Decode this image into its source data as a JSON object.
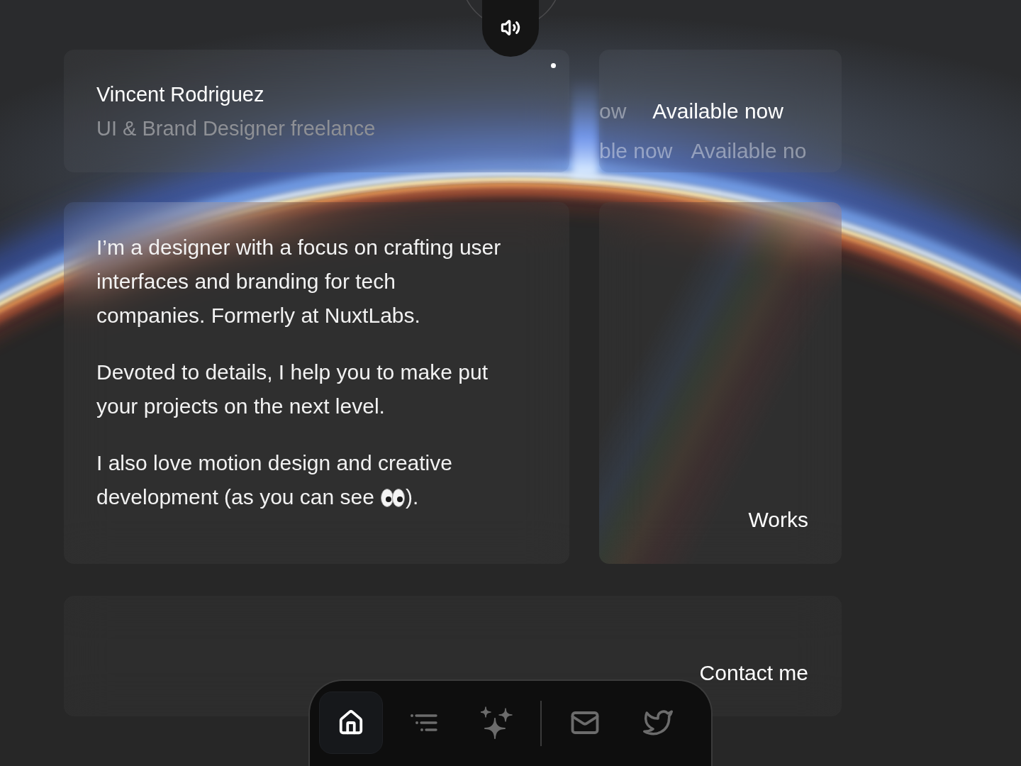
{
  "sound_button": {
    "on": true
  },
  "profile": {
    "name": "Vincent Rodriguez",
    "role": "UI & Brand Designer freelance"
  },
  "availability": {
    "rows": [
      {
        "items": [
          {
            "text": "ow",
            "faded": true
          },
          {
            "text": "Available now",
            "faded": false
          }
        ]
      },
      {
        "items": [
          {
            "text": "ble now",
            "faded": true
          },
          {
            "text": "Available no",
            "faded": true
          }
        ]
      }
    ]
  },
  "about": {
    "paragraphs": [
      {
        "parts": [
          "I’m a designer with a focus on crafting user interfaces and branding for tech companies. Formerly at NuxtLabs."
        ]
      },
      {
        "parts": [
          "Devoted to details, I help you to make put your projects on the next level."
        ]
      },
      {
        "parts": [
          "I also love motion design and creative development (as you can see",
          ")."
        ]
      }
    ]
  },
  "works": {
    "label": "Works"
  },
  "contact": {
    "label": "Contact me"
  },
  "nav": {
    "groups": [
      {
        "items": [
          {
            "selected": true
          },
          {
            "selected": false
          },
          {
            "selected": false
          }
        ]
      },
      {
        "items": [
          {
            "selected": false
          },
          {
            "selected": false
          }
        ]
      }
    ]
  }
}
